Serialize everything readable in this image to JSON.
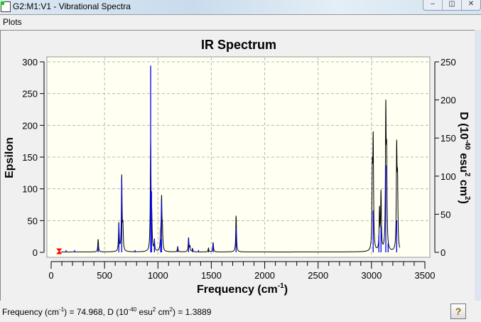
{
  "window": {
    "title": "G2:M1:V1 - Vibrational Spectra",
    "buttons": [
      "‒",
      "◫",
      "✕"
    ]
  },
  "menu": {
    "items": [
      "Plots"
    ]
  },
  "status": {
    "p1": "Frequency (cm",
    "s1": "-1",
    "p2": ") = 74.968, D (10",
    "s2": "-40",
    "p3": " esu",
    "s3": "2",
    "p4": " cm",
    "s4": "2",
    "p5": ") = 1.3889"
  },
  "help_button": "?",
  "colors": {
    "sticks": "#0000ff",
    "curve": "#000000",
    "marker": "#ff0000",
    "plot_bg": "#fffff2",
    "grid": "#b8b8b8"
  },
  "chart_data": {
    "type": "line",
    "title": "IR Spectrum",
    "xlabel": "Frequency (cm",
    "xlabel_sup": "-1",
    "xlabel_end": ")",
    "ylabel_left": "Epsilon",
    "ylabel_right": "D (10",
    "ylabel_right_sup1": "-40",
    "ylabel_right_mid": " esu",
    "ylabel_right_sup2": "2",
    "ylabel_right_mid2": " cm",
    "ylabel_right_sup3": "2",
    "ylabel_right_end": ")",
    "xlim": [
      0,
      3500
    ],
    "ylim_left": [
      0,
      300
    ],
    "ylim_right": [
      0,
      250
    ],
    "xticks": [
      0,
      500,
      1000,
      1500,
      2000,
      2500,
      3000,
      3500
    ],
    "yticks_left": [
      0,
      50,
      100,
      150,
      200,
      250,
      300
    ],
    "yticks_right": [
      0,
      50,
      100,
      150,
      200,
      250
    ],
    "grid": true,
    "selected_mode": {
      "frequency": 74.968,
      "D": 1.3889
    },
    "sticks_D": [
      [
        75,
        1.4
      ],
      [
        140,
        3
      ],
      [
        220,
        3
      ],
      [
        440,
        8
      ],
      [
        634,
        36
      ],
      [
        661,
        97
      ],
      [
        786,
        3
      ],
      [
        932,
        245
      ],
      [
        940,
        80
      ],
      [
        967,
        18
      ],
      [
        1025,
        17
      ],
      [
        1034,
        67
      ],
      [
        1185,
        6
      ],
      [
        1287,
        18
      ],
      [
        1324,
        4
      ],
      [
        1380,
        3
      ],
      [
        1473,
        3
      ],
      [
        1517,
        12
      ],
      [
        1732,
        31
      ],
      [
        3016,
        55
      ],
      [
        3069,
        22
      ],
      [
        3089,
        34
      ],
      [
        3134,
        114
      ],
      [
        3156,
        12
      ],
      [
        3236,
        42
      ]
    ],
    "curve_peaks_epsilon": [
      [
        440,
        20
      ],
      [
        634,
        44
      ],
      [
        661,
        117
      ],
      [
        672,
        35
      ],
      [
        932,
        169
      ],
      [
        942,
        45
      ],
      [
        967,
        15
      ],
      [
        1025,
        20
      ],
      [
        1034,
        80
      ],
      [
        1042,
        30
      ],
      [
        1185,
        8
      ],
      [
        1287,
        22
      ],
      [
        1300,
        8
      ],
      [
        1324,
        5
      ],
      [
        1473,
        6
      ],
      [
        1517,
        15
      ],
      [
        1732,
        57
      ],
      [
        3008,
        115
      ],
      [
        3016,
        166
      ],
      [
        3075,
        63
      ],
      [
        3089,
        90
      ],
      [
        3134,
        212
      ],
      [
        3142,
        132
      ],
      [
        3236,
        156
      ],
      [
        3244,
        100
      ]
    ]
  }
}
